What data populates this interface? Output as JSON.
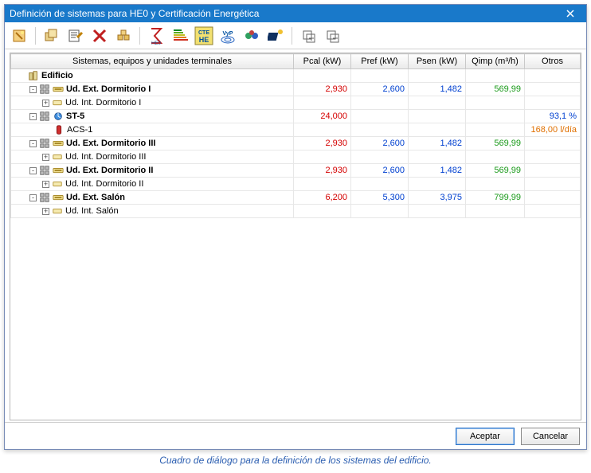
{
  "window": {
    "title": "Definición de sistemas para HE0 y Certificación Energética"
  },
  "columns": {
    "tree": "Sistemas, equipos y unidades terminales",
    "pcal": "Pcal (kW)",
    "pref": "Pref (kW)",
    "psen": "Psen (kW)",
    "qimp": "Qimp (m³/h)",
    "otros": "Otros"
  },
  "rows": [
    {
      "label": "Edificio",
      "level": 0,
      "bold": true,
      "toggle": "",
      "icon": "building"
    },
    {
      "label": "Ud. Ext. Dormitorio I",
      "level": 1,
      "bold": true,
      "toggle": "-",
      "icon": "unit",
      "prefix": "sys",
      "pcal": "2,930",
      "pref": "2,600",
      "psen": "1,482",
      "qimp": "569,99"
    },
    {
      "label": "Ud. Int. Dormitorio I",
      "level": 2,
      "bold": false,
      "toggle": "+",
      "icon": "sub"
    },
    {
      "label": "ST-5",
      "level": 1,
      "bold": true,
      "toggle": "-",
      "icon": "st",
      "prefix": "sys",
      "pcal": "24,000",
      "otros": "93,1 %",
      "otrosClass": "num-blue"
    },
    {
      "label": "ACS-1",
      "level": 2,
      "bold": false,
      "toggle": "",
      "icon": "red",
      "otros": "168,00 l/día",
      "otrosClass": "num-orange"
    },
    {
      "label": "Ud. Ext. Dormitorio III",
      "level": 1,
      "bold": true,
      "toggle": "-",
      "icon": "unit",
      "prefix": "sys",
      "pcal": "2,930",
      "pref": "2,600",
      "psen": "1,482",
      "qimp": "569,99"
    },
    {
      "label": "Ud. Int. Dormitorio III",
      "level": 2,
      "bold": false,
      "toggle": "+",
      "icon": "sub"
    },
    {
      "label": "Ud. Ext. Dormitorio II",
      "level": 1,
      "bold": true,
      "toggle": "-",
      "icon": "unit",
      "prefix": "sys",
      "pcal": "2,930",
      "pref": "2,600",
      "psen": "1,482",
      "qimp": "569,99"
    },
    {
      "label": "Ud. Int. Dormitorio II",
      "level": 2,
      "bold": false,
      "toggle": "+",
      "icon": "sub"
    },
    {
      "label": "Ud. Ext. Salón",
      "level": 1,
      "bold": true,
      "toggle": "-",
      "icon": "unit",
      "prefix": "sys",
      "pcal": "6,200",
      "pref": "5,300",
      "psen": "3,975",
      "qimp": "799,99"
    },
    {
      "label": "Ud. Int. Salón",
      "level": 2,
      "bold": false,
      "toggle": "+",
      "icon": "sub"
    }
  ],
  "buttons": {
    "ok": "Aceptar",
    "cancel": "Cancelar"
  },
  "caption": "Cuadro de diálogo para la definición de los sistemas del edificio."
}
